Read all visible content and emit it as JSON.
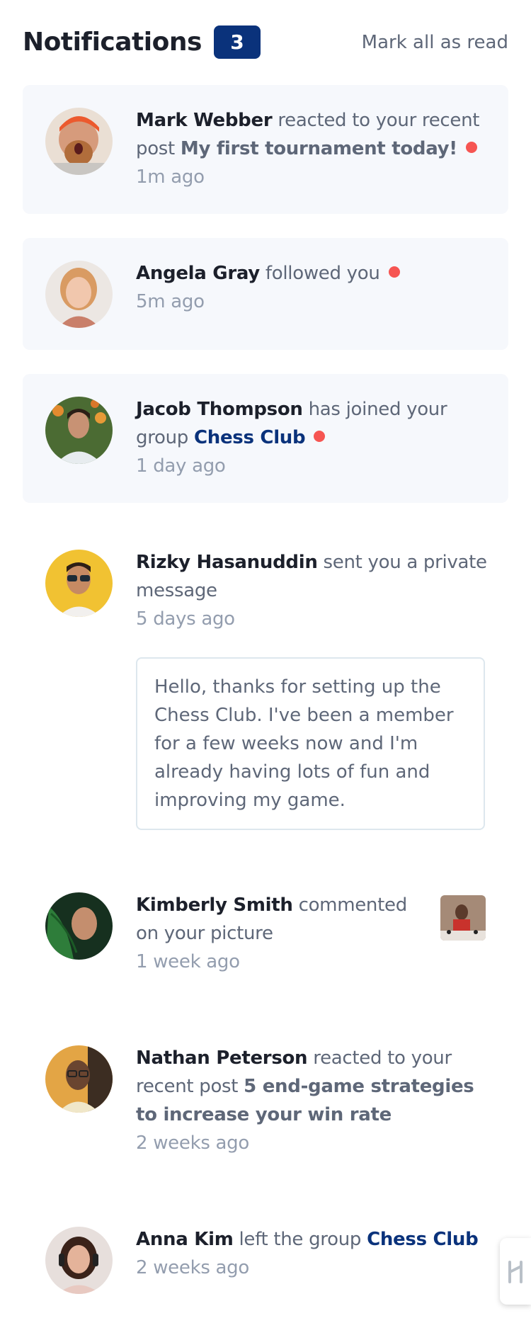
{
  "header": {
    "title": "Notifications",
    "count": "3",
    "mark_all": "Mark all as read"
  },
  "notifications": [
    {
      "name": "Mark Webber",
      "action": "reacted to your recent post",
      "post": "My first tournament today!",
      "time": "1m ago",
      "unread": true
    },
    {
      "name": "Angela Gray",
      "action": "followed you",
      "time": "5m ago",
      "unread": true
    },
    {
      "name": "Jacob Thompson",
      "action": "has joined your group",
      "group": "Chess Club",
      "time": "1 day ago",
      "unread": true
    },
    {
      "name": "Rizky Hasanuddin",
      "action": "sent you a private message",
      "time": "5 days ago",
      "message": "Hello, thanks for setting up the Chess Club. I've been a member for a few weeks now and I'm already having lots of fun and improving my game.",
      "unread": false
    },
    {
      "name": "Kimberly Smith",
      "action": "commented on your picture",
      "time": "1 week ago",
      "unread": false
    },
    {
      "name": "Nathan Peterson",
      "action": "reacted to your recent post",
      "post": "5 end-game strategies to increase your win rate",
      "time": "2 weeks ago",
      "unread": false
    },
    {
      "name": "Anna Kim",
      "action": "left the group",
      "group": "Chess Club",
      "time": "2 weeks ago",
      "unread": false
    }
  ],
  "colors": {
    "unread_bg": "#f6f8fc",
    "badge": "#0a327b",
    "dot": "#f65552"
  }
}
